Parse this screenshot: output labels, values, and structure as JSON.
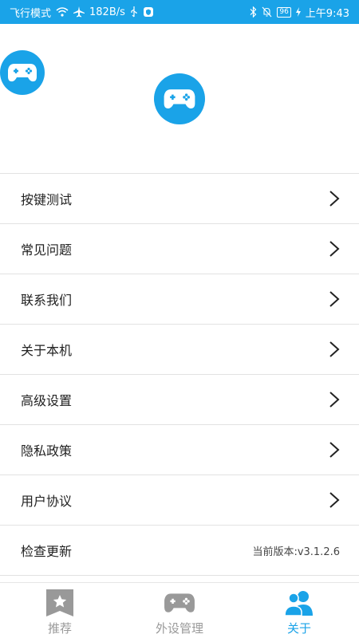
{
  "status_bar": {
    "airplane_mode": "飞行模式",
    "speed": "182B/s",
    "battery": "96",
    "time": "上午9:43"
  },
  "colors": {
    "accent": "#1aa3e8",
    "text": "#222222",
    "divider": "#e2e2e2",
    "inactive": "#999999"
  },
  "menu": {
    "items": [
      {
        "label": "按键测试",
        "icon": "chevron-right-icon"
      },
      {
        "label": "常见问题",
        "icon": "chevron-right-icon"
      },
      {
        "label": "联系我们",
        "icon": "chevron-right-icon"
      },
      {
        "label": "关于本机",
        "icon": "chevron-right-icon"
      },
      {
        "label": "高级设置",
        "icon": "chevron-right-icon"
      },
      {
        "label": "隐私政策",
        "icon": "chevron-right-icon"
      },
      {
        "label": "用户协议",
        "icon": "chevron-right-icon"
      },
      {
        "label": "检查更新",
        "version": "当前版本:v3.1.2.6"
      }
    ]
  },
  "tabbar": {
    "tabs": [
      {
        "label": "推荐",
        "icon": "star-bookmark-icon"
      },
      {
        "label": "外设管理",
        "icon": "gamepad-icon"
      },
      {
        "label": "关于",
        "icon": "users-icon",
        "active": true
      }
    ]
  }
}
